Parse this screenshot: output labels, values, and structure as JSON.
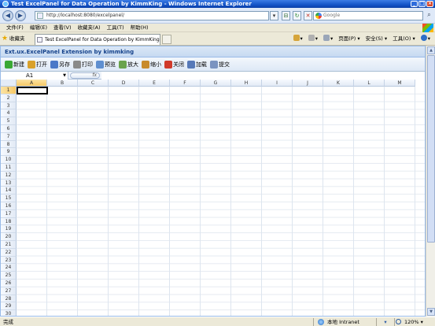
{
  "window": {
    "title": "Test ExcelPanel for Data Operation by KimmKing - Windows Internet Explorer"
  },
  "address": {
    "url": "http://localhost:8080/excelpanel/",
    "search_placeholder": "Google"
  },
  "menu": [
    "文件(F)",
    "编辑(E)",
    "查看(V)",
    "收藏夹(A)",
    "工具(T)",
    "帮助(H)"
  ],
  "favorites": {
    "label": "收藏夹",
    "tab_title": "Test ExcelPanel for Data Operation by KimmKing"
  },
  "commands": {
    "page": "页面(P)",
    "safety": "安全(S)",
    "tools": "工具(O)"
  },
  "panel": {
    "title": "Ext.ux.ExcelPanel Extension by kimmking"
  },
  "toolbar": [
    {
      "label": "新建",
      "icon": "new-icon",
      "color": "#3aa835"
    },
    {
      "label": "打开",
      "icon": "open-icon",
      "color": "#d9a12c"
    },
    {
      "label": "另存",
      "icon": "save-icon",
      "color": "#4a78c8"
    },
    {
      "label": "打印",
      "icon": "print-icon",
      "color": "#8a8a8a"
    },
    {
      "label": "预览",
      "icon": "preview-icon",
      "color": "#5f8fd0"
    },
    {
      "label": "放大",
      "icon": "zoom-in-icon",
      "color": "#6aa34c"
    },
    {
      "label": "缩小",
      "icon": "zoom-out-icon",
      "color": "#c88a2a"
    },
    {
      "label": "关闭",
      "icon": "close-icon",
      "color": "#d03a2a"
    },
    {
      "label": "加载",
      "icon": "load-icon",
      "color": "#5779b8"
    },
    {
      "label": "提交",
      "icon": "submit-icon",
      "color": "#7a93c0"
    }
  ],
  "formula": {
    "cell_ref": "A1",
    "fx": "fx",
    "value": ""
  },
  "sheet": {
    "columns": [
      "A",
      "B",
      "C",
      "D",
      "E",
      "F",
      "G",
      "H",
      "I",
      "J",
      "K",
      "L",
      "M"
    ],
    "rows": [
      "1",
      "2",
      "3",
      "4",
      "5",
      "6",
      "7",
      "8",
      "9",
      "10",
      "11",
      "12",
      "13",
      "14",
      "15",
      "16",
      "17",
      "18",
      "19",
      "20",
      "21",
      "22",
      "23",
      "24",
      "25",
      "26",
      "27",
      "28",
      "29",
      "30"
    ],
    "selected_cell": "A1"
  },
  "status": {
    "text": "完成",
    "zone": "本地 Intranet",
    "zoom": "120%"
  }
}
